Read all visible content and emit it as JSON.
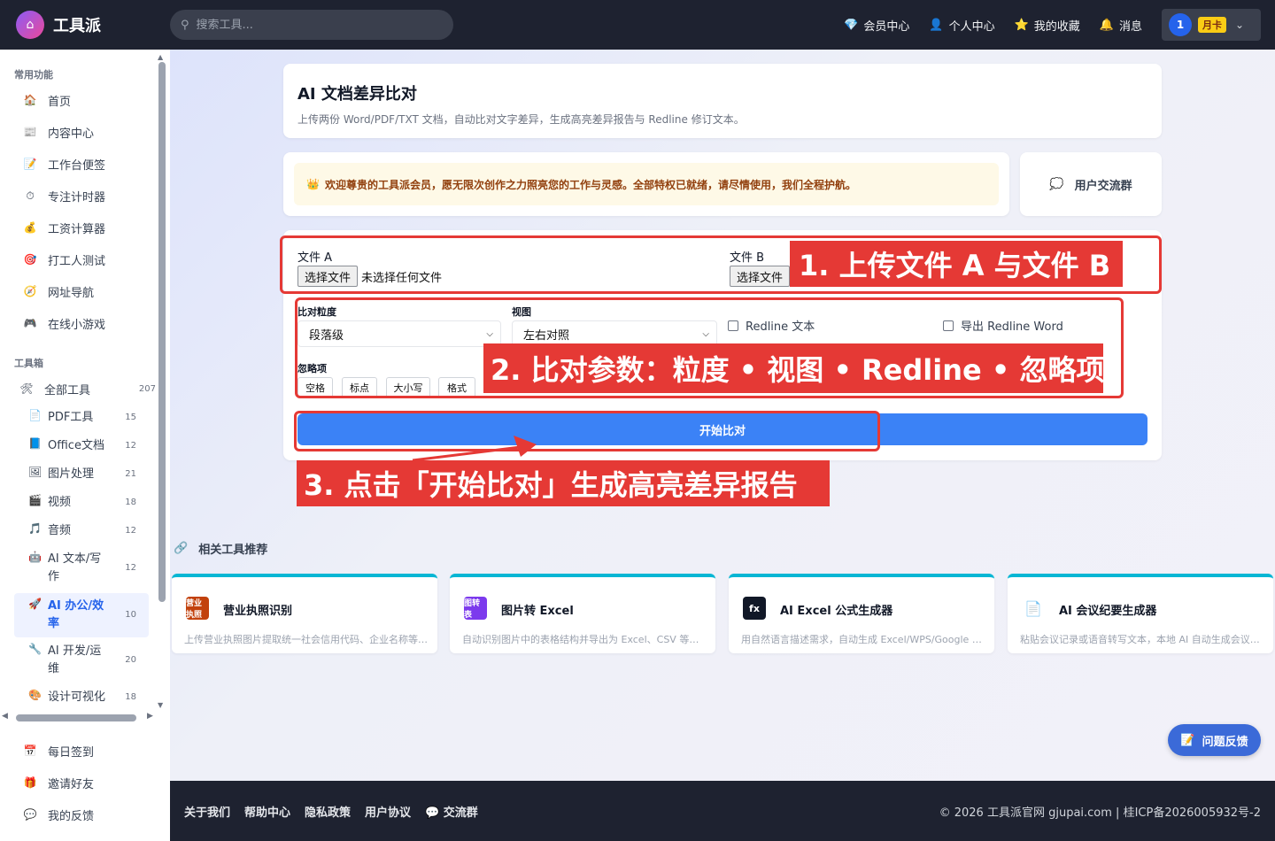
{
  "app": {
    "name": "工具派",
    "search_placeholder": "搜索工具..."
  },
  "topnav": {
    "items": [
      {
        "icon": "diamond-icon",
        "glyph": "💎",
        "label": "会员中心"
      },
      {
        "icon": "person-icon",
        "glyph": "👤",
        "label": "个人中心"
      },
      {
        "icon": "star-icon",
        "glyph": "⭐",
        "label": "我的收藏"
      },
      {
        "icon": "bell-icon",
        "glyph": "🔔",
        "label": "消息"
      }
    ],
    "user": {
      "avatar_text": "1",
      "plan_badge": "月卡"
    }
  },
  "sidebar": {
    "section_common": "常用功能",
    "common_items": [
      {
        "icon": "home-icon",
        "glyph": "🏠",
        "label": "首页"
      },
      {
        "icon": "content-icon",
        "glyph": "📰",
        "label": "内容中心"
      },
      {
        "icon": "memo-icon",
        "glyph": "📝",
        "label": "工作台便签"
      },
      {
        "icon": "timer-icon",
        "glyph": "⏱",
        "label": "专注计时器"
      },
      {
        "icon": "money-bag-icon",
        "glyph": "💰",
        "label": "工资计算器"
      },
      {
        "icon": "target-icon",
        "glyph": "🎯",
        "label": "打工人测试"
      },
      {
        "icon": "compass-icon",
        "glyph": "🧭",
        "label": "网址导航"
      },
      {
        "icon": "gamepad-icon",
        "glyph": "🎮",
        "label": "在线小游戏"
      }
    ],
    "section_tools": "工具箱",
    "all_tools": {
      "icon": "tools-icon",
      "glyph": "🛠",
      "label": "全部工具",
      "count": "207"
    },
    "tool_categories": [
      {
        "icon": "pdf-icon",
        "glyph": "📄",
        "label": "PDF工具",
        "count": "15"
      },
      {
        "icon": "office-icon",
        "glyph": "📘",
        "label": "Office文档",
        "count": "12"
      },
      {
        "icon": "image-icon",
        "glyph": "🖼",
        "label": "图片处理",
        "count": "21"
      },
      {
        "icon": "video-icon",
        "glyph": "🎬",
        "label": "视频",
        "count": "18"
      },
      {
        "icon": "music-icon",
        "glyph": "🎵",
        "label": "音频",
        "count": "12"
      },
      {
        "icon": "robot-icon",
        "glyph": "🤖",
        "label": "AI 文本/写作",
        "count": "12"
      },
      {
        "icon": "rocket-icon",
        "glyph": "🚀",
        "label": "AI 办公/效率",
        "count": "10"
      },
      {
        "icon": "wrench-icon",
        "glyph": "🔧",
        "label": "AI 开发/运维",
        "count": "20"
      },
      {
        "icon": "palette-icon",
        "glyph": "🎨",
        "label": "设计可视化",
        "count": "18"
      }
    ],
    "bottom_items": [
      {
        "icon": "calendar-icon",
        "glyph": "📅",
        "label": "每日签到"
      },
      {
        "icon": "gift-icon",
        "glyph": "🎁",
        "label": "邀请好友"
      },
      {
        "icon": "chat-icon",
        "glyph": "💬",
        "label": "我的反馈"
      }
    ]
  },
  "page": {
    "title": "AI 文档差异比对",
    "subtitle": "上传两份 Word/PDF/TXT 文档，自动比对文字差异，生成高亮差异报告与 Redline 修订文本。",
    "welcome": {
      "icon": "crown-icon",
      "glyph": "👑",
      "text": "欢迎尊贵的工具派会员，愿无限次创作之力照亮您的工作与灵感。全部特权已就绪，请尽情使用，我们全程护航。"
    },
    "group": {
      "icon": "speech-bubble-icon",
      "glyph": "💭",
      "label": "用户交流群"
    }
  },
  "form": {
    "file_a_label": "文件 A",
    "file_b_label": "文件 B",
    "choose_file": "选择文件",
    "no_file": "未选择任何文件",
    "granularity_label": "比对粒度",
    "granularity_value": "段落级",
    "view_label": "视图",
    "view_value": "左右对照",
    "redline_text": "Redline 文本",
    "export_word": "导出 Redline Word",
    "ignore_label": "忽略项",
    "ignore_options": [
      "空格",
      "标点",
      "大小写",
      "格式"
    ],
    "start_button": "开始比对"
  },
  "annotations": {
    "step1": "1. 上传文件 A 与文件 B",
    "step2": "2. 比对参数：粒度 • 视图 • Redline • 忽略项",
    "step3": "3. 点击「开始比对」生成高亮差异报告",
    "color": "#e53935"
  },
  "related": {
    "title": "相关工具推荐",
    "tools": [
      {
        "icon": "license-icon",
        "icon_text": "营业执照",
        "color": "#c2410c",
        "name": "营业执照识别",
        "desc": "上传营业执照图片提取统一社会信用代码、企业名称等信息"
      },
      {
        "icon": "image-to-table-icon",
        "icon_text": "图转表",
        "color": "#7c3aed",
        "name": "图片转 Excel",
        "desc": "自动识别图片中的表格结构并导出为 Excel、CSV 等格式"
      },
      {
        "icon": "fx-icon",
        "icon_text": "fx",
        "color": "#111827",
        "name": "AI Excel 公式生成器",
        "desc": "用自然语言描述需求，自动生成 Excel/WPS/Google Sheets 公式"
      },
      {
        "icon": "meeting-notes-icon",
        "icon_text": "📄",
        "color": "#ffffff",
        "name": "AI 会议纪要生成器",
        "desc": "粘贴会议记录或语音转写文本，本地 AI 自动生成会议纪要"
      }
    ]
  },
  "feedback": {
    "label": "问题反馈",
    "glyph": "📝"
  },
  "footer": {
    "links": [
      "关于我们",
      "帮助中心",
      "隐私政策",
      "用户协议",
      "💬 交流群"
    ],
    "copyright": "© 2026 工具派官网 gjupai.com | 桂ICP备2026005932号-2"
  },
  "colors": {
    "topbar": "#1e2230",
    "accent": "#3b82f6",
    "annotation": "#e53935"
  }
}
